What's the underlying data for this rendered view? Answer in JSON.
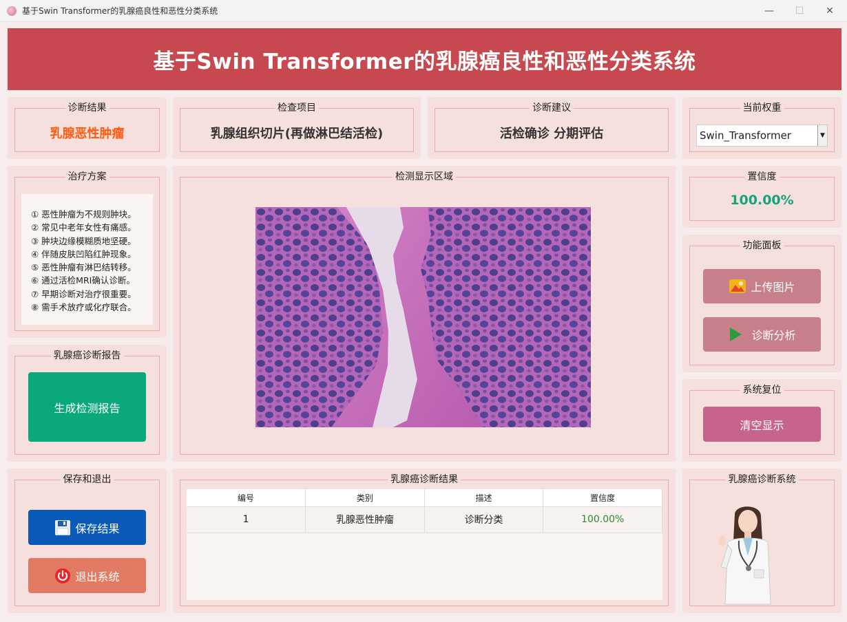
{
  "window": {
    "title": "基于Swin Transformer的乳腺癌良性和恶性分类系统",
    "minimize": "—",
    "maximize": "☐",
    "close": "✕"
  },
  "header": {
    "title": "基于Swin Transformer的乳腺癌良性和恶性分类系统"
  },
  "diagnosis_result": {
    "label": "诊断结果",
    "value": "乳腺恶性肿瘤",
    "color": "#ff5a0e"
  },
  "exam_item": {
    "label": "检查项目",
    "value": "乳腺组织切片(再做淋巴结活检)"
  },
  "advice": {
    "label": "诊断建议",
    "value": "活检确诊 分期评估"
  },
  "weight": {
    "label": "当前权重",
    "selected": "Swin_Transformer"
  },
  "treatment": {
    "label": "治疗方案",
    "items": [
      "① 恶性肿瘤为不规则肿块。",
      "② 常见中老年女性有痛感。",
      "③ 肿块边缘模糊质地坚硬。",
      "④ 伴随皮肤凹陷红肿现象。",
      "⑤ 恶性肿瘤有淋巴结转移。",
      "⑥ 通过活检MRI确认诊断。",
      "⑦ 早期诊断对治疗很重要。",
      "⑧ 需手术放疗或化疗联合。"
    ]
  },
  "display": {
    "label": "检测显示区域"
  },
  "confidence": {
    "label": "置信度",
    "value": "100.00%",
    "color": "#15a37a"
  },
  "functions": {
    "label": "功能面板",
    "upload": "上传图片",
    "analyze": "诊断分析"
  },
  "report": {
    "label": "乳腺癌诊断报告",
    "generate": "生成检测报告"
  },
  "reset": {
    "label": "系统复位",
    "clear": "清空显示"
  },
  "save_exit": {
    "label": "保存和退出",
    "save": "保存结果",
    "exit": "退出系统"
  },
  "results": {
    "label": "乳腺癌诊断结果",
    "columns": [
      "编号",
      "类别",
      "描述",
      "置信度"
    ],
    "rows": [
      [
        "1",
        "乳腺恶性肿瘤",
        "诊断分类",
        "100.00%"
      ]
    ]
  },
  "system_panel": {
    "label": "乳腺癌诊断系统"
  },
  "colors": {
    "header": "#c8484f",
    "report_button": "#0aa87a",
    "save_button": "#0b5ab8",
    "exit_button": "#e27a63",
    "func_button": "#c77f8a",
    "clear_button": "#c7648e"
  }
}
